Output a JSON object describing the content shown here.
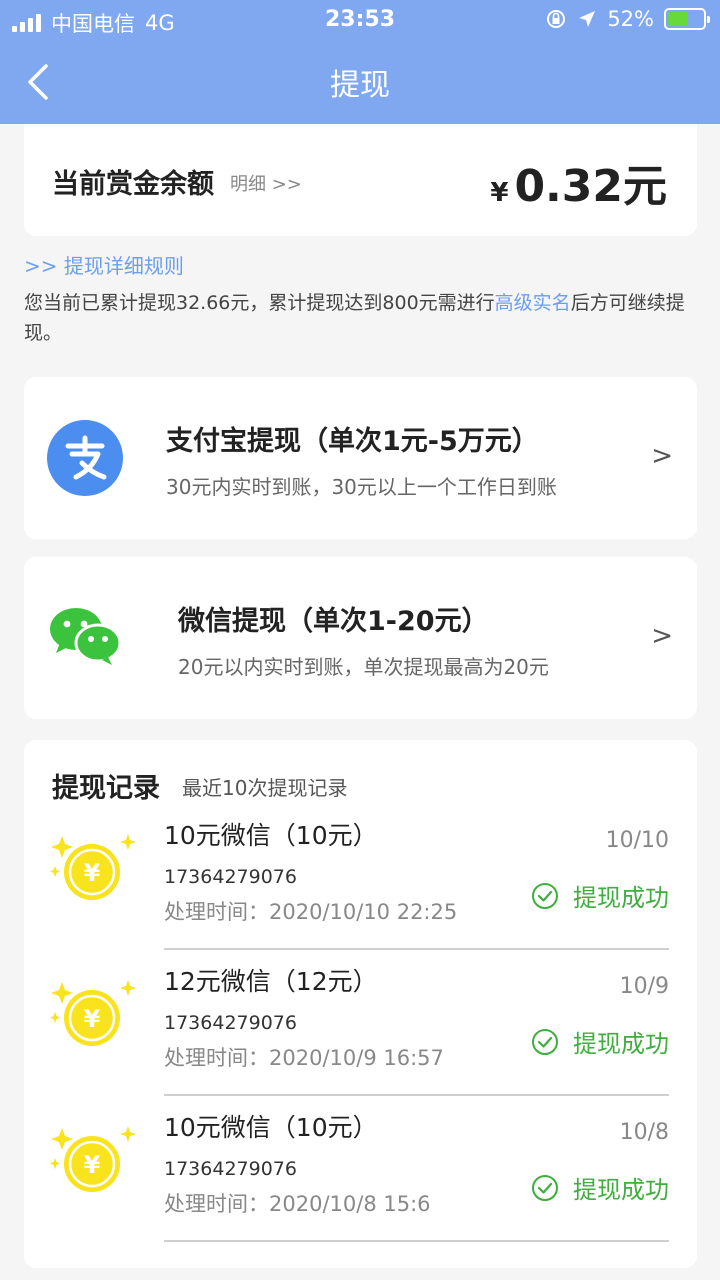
{
  "status_bar": {
    "carrier": "中国电信",
    "network": "4G",
    "time": "23:53",
    "battery": "52%"
  },
  "nav": {
    "title": "提现"
  },
  "balance": {
    "label": "当前赏金余额",
    "detail_link": "明细 >>",
    "currency": "¥",
    "amount": "0.32元"
  },
  "rules": {
    "link": ">> 提现详细规则",
    "notice_before": "您当前已累计提现32.66元，累计提现达到800元需进行",
    "notice_highlight": "高级实名",
    "notice_after": "后方可继续提现。"
  },
  "payment_methods": [
    {
      "icon": "alipay-icon",
      "title": "支付宝提现（单次1元-5万元）",
      "subtitle": "30元内实时到账，30元以上一个工作日到账",
      "arrow": ">"
    },
    {
      "icon": "wechat-icon",
      "title": "微信提现（单次1-20元）",
      "subtitle": "20元以内实时到账，单次提现最高为20元",
      "arrow": ">"
    }
  ],
  "records": {
    "title": "提现记录",
    "hint": "最近10次提现记录",
    "time_label": "处理时间：",
    "items": [
      {
        "name": "10元微信（10元）",
        "date": "10/10",
        "phone": "17364279076",
        "time": "2020/10/10 22:25",
        "status": "提现成功"
      },
      {
        "name": "12元微信（12元）",
        "date": "10/9",
        "phone": "17364279076",
        "time": "2020/10/9 16:57",
        "status": "提现成功"
      },
      {
        "name": "10元微信（10元）",
        "date": "10/8",
        "phone": "17364279076",
        "time": "2020/10/8 15:6",
        "status": "提现成功"
      }
    ]
  },
  "colors": {
    "header": "#7fa8f1",
    "link": "#6c9ef0",
    "success": "#3fae3f",
    "alipay": "#4b8ef0",
    "wechat": "#3cc33e",
    "coin": "#f8e31c"
  }
}
